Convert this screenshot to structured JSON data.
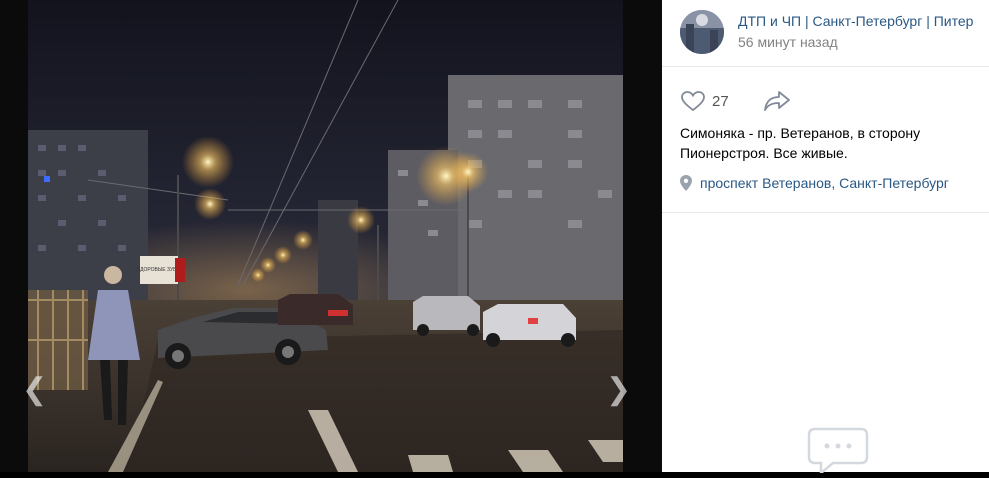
{
  "post": {
    "group_name": "ДТП и ЧП | Санкт-Петербург | Питер",
    "time": "56 минут назад",
    "likes": "27",
    "text": "Симоняка - пр. Ветеранов, в сторону Пионерстроя. Все живые.",
    "location": "проспект Ветеранов, Санкт-Петербург"
  },
  "photo": {
    "street_sign": "ЗДОРОВЫЕ ЗУБЫ"
  },
  "icons": {
    "like": "heart-icon",
    "share": "share-arrow-icon",
    "location": "map-pin-icon",
    "comments": "comment-bubble-icon",
    "prev": "chevron-left-icon",
    "next": "chevron-right-icon"
  },
  "nav": {
    "prev_glyph": "❮",
    "next_glyph": "❯"
  },
  "colors": {
    "link": "#2a5885",
    "muted": "#828282",
    "viewer_bg": "#0b0b0b",
    "panel_bg": "#ffffff"
  }
}
